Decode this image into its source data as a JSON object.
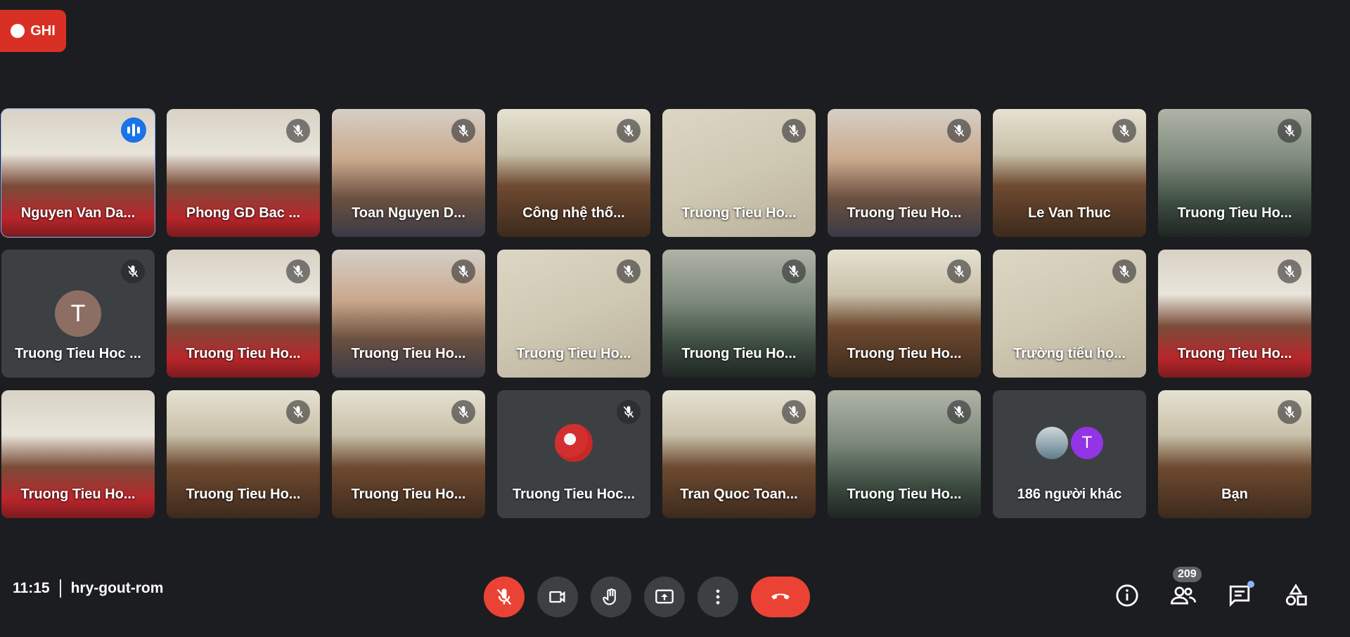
{
  "recording": {
    "label": "GHI",
    "color": "#d93025"
  },
  "tiles": [
    {
      "name": "Nguyen Van Da...",
      "muted": false,
      "speaking": true,
      "scene": "room-red"
    },
    {
      "name": "Phong GD Bac ...",
      "muted": true,
      "scene": "room-red"
    },
    {
      "name": "Toan Nguyen D...",
      "muted": true,
      "scene": "face"
    },
    {
      "name": "Công nhệ thố...",
      "muted": true,
      "scene": "classroom"
    },
    {
      "name": "Truong Tieu Ho...",
      "muted": true,
      "scene": "wall"
    },
    {
      "name": "Truong Tieu Ho...",
      "muted": true,
      "scene": "face"
    },
    {
      "name": "Le Van Thuc",
      "muted": true,
      "scene": "classroom"
    },
    {
      "name": "Truong Tieu Ho...",
      "muted": true,
      "scene": "screen"
    },
    {
      "name": "Truong Tieu Hoc ...",
      "muted": true,
      "scene": "avatar",
      "avatar_letter": "T",
      "avatar_color": "#8d6e63"
    },
    {
      "name": "Truong Tieu Ho...",
      "muted": true,
      "scene": "room-red"
    },
    {
      "name": "Truong Tieu Ho...",
      "muted": true,
      "scene": "face"
    },
    {
      "name": "Truong Tieu Ho...",
      "muted": true,
      "scene": "wall"
    },
    {
      "name": "Truong Tieu Ho...",
      "muted": true,
      "scene": "screen"
    },
    {
      "name": "Truong Tieu Ho...",
      "muted": true,
      "scene": "classroom"
    },
    {
      "name": "Trường tiểu họ...",
      "muted": true,
      "scene": "wall"
    },
    {
      "name": "Truong Tieu Ho...",
      "muted": true,
      "scene": "room-red"
    },
    {
      "name": "Truong Tieu Ho...",
      "muted": false,
      "scene": "room-red"
    },
    {
      "name": "Truong Tieu Ho...",
      "muted": true,
      "scene": "classroom"
    },
    {
      "name": "Truong Tieu Ho...",
      "muted": true,
      "scene": "classroom"
    },
    {
      "name": "Truong Tieu Hoc...",
      "muted": true,
      "scene": "avatar-photo"
    },
    {
      "name": "Tran Quoc Toan...",
      "muted": true,
      "scene": "classroom"
    },
    {
      "name": "Truong Tieu Ho...",
      "muted": true,
      "scene": "screen"
    },
    {
      "name": "186 người khác",
      "muted": false,
      "scene": "others",
      "others_letter": "T"
    },
    {
      "name": "Bạn",
      "muted": true,
      "scene": "classroom"
    }
  ],
  "meeting": {
    "time": "11:15",
    "code": "hry-gout-rom"
  },
  "participants_count": "209",
  "icons": {
    "mic": "mic-off-icon",
    "camera": "camera-icon",
    "hand": "raise-hand-icon",
    "present": "present-screen-icon",
    "more": "more-options-icon",
    "hangup": "hang-up-icon",
    "info": "info-icon",
    "people": "people-icon",
    "chat": "chat-icon",
    "activities": "activities-icon"
  },
  "colors": {
    "accent": "#8ab4f8",
    "danger": "#ea4335",
    "tile_bg": "#3c4043",
    "speaker": "#1a73e8"
  }
}
